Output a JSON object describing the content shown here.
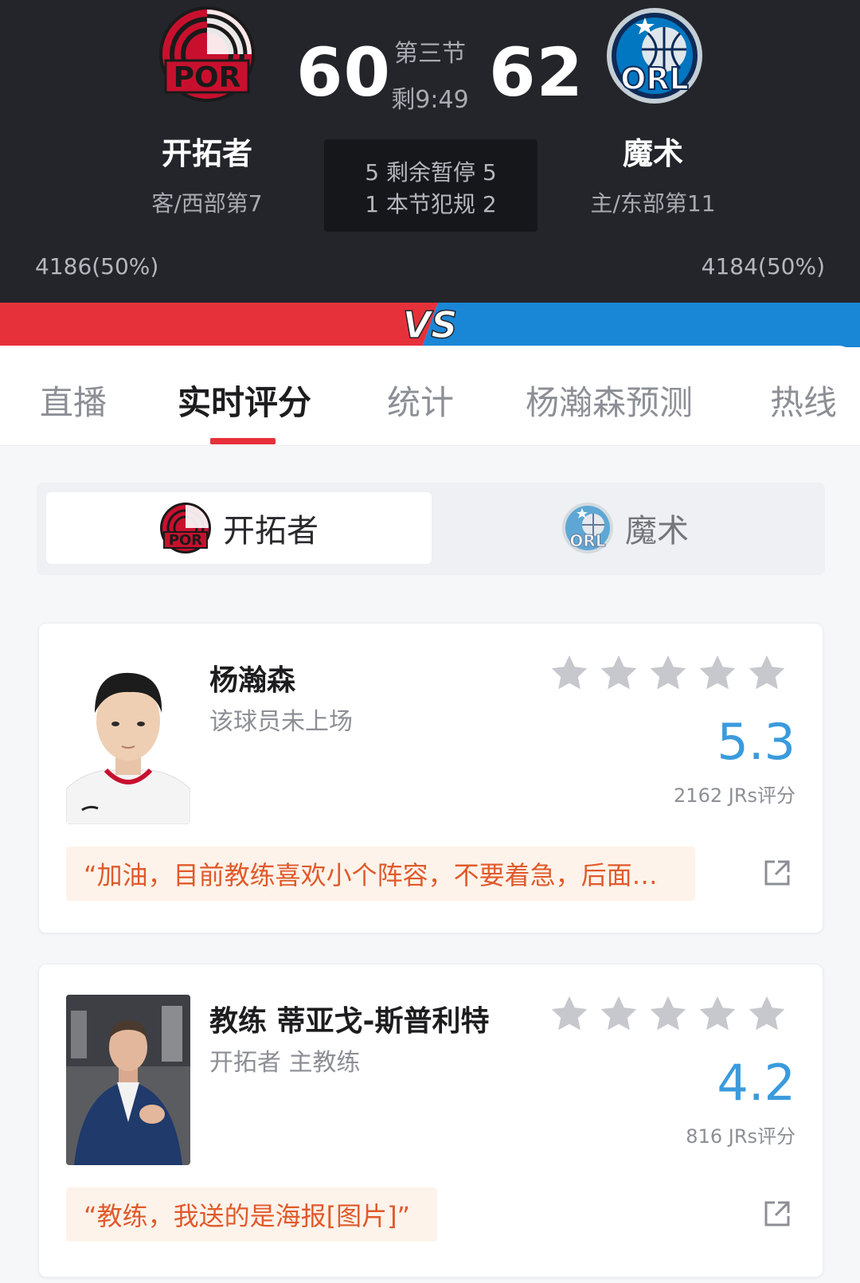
{
  "header": {
    "away_team": {
      "name": "开拓者",
      "abbr": "POR",
      "sub": "客/西部第7",
      "score": "60",
      "support": "4186(50%)",
      "color": "#c8102e"
    },
    "home_team": {
      "name": "魔术",
      "abbr": "ORL",
      "sub": "主/东部第11",
      "score": "62",
      "support": "4184(50%)",
      "color": "#0077c0"
    },
    "period": "第三节",
    "clock": "剩9:49",
    "box": {
      "row1": "5 剩余暂停 5",
      "row2": "1 本节犯规 2"
    }
  },
  "vs_text": "VS",
  "tabs": [
    {
      "label": "直播",
      "active": false
    },
    {
      "label": "实时评分",
      "active": true
    },
    {
      "label": "统计",
      "active": false
    },
    {
      "label": "杨瀚森预测",
      "active": false
    },
    {
      "label": "热线",
      "active": false
    }
  ],
  "team_switch": [
    {
      "label": "开拓者",
      "active": true
    },
    {
      "label": "魔术",
      "active": false
    }
  ],
  "cards": [
    {
      "name": "杨瀚森",
      "sub": "该球员未上场",
      "rating": "5.3",
      "raters": "2162 JRs评分",
      "comment": "“加油，目前教练喜欢小个阵容，不要着急，后面…",
      "stars_filled": 0
    },
    {
      "name": "教练 蒂亚戈-斯普利特",
      "sub": "开拓者 主教练",
      "rating": "4.2",
      "raters": "816 JRs评分",
      "comment": "“教练，我送的是海报[图片]”",
      "stars_filled": 0
    }
  ],
  "colors": {
    "accent_red": "#e6313a",
    "rating_blue": "#3a9bdc",
    "comment_orange": "#e05a2b",
    "header_bg": "#24252a"
  }
}
